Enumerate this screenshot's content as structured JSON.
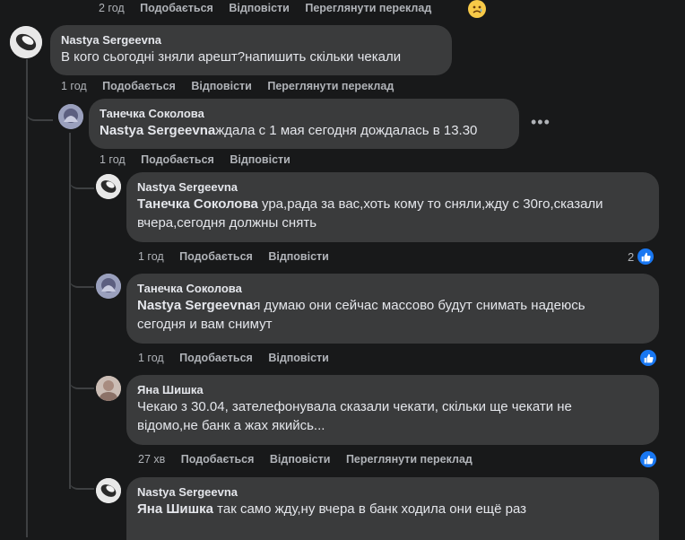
{
  "top_row": {
    "time": "2 год",
    "like": "Подобається",
    "reply": "Відповісти",
    "translate": "Переглянути переклад"
  },
  "comments": [
    {
      "author": "Nastya Sergeevna",
      "tag": "",
      "text": "В кого сьогодні зняли арешт?напишить скільки чекали",
      "time": "1 год",
      "like": "Подобається",
      "reply": "Відповісти",
      "translate": "Переглянути переклад"
    },
    {
      "author": "Танечка Соколова",
      "tag": "Nastya Sergeevna",
      "text": "ждала с 1 мая сегодня дождалась в 13.30",
      "time": "1 год",
      "like": "Подобається",
      "reply": "Відповісти"
    },
    {
      "author": "Nastya Sergeevna",
      "tag": "Танечка Соколова",
      "text_line1": " ура,рада за вас,хоть кому то сняли,жду с 30го,сказали",
      "text_line2": "вчера,сегодня должны снять",
      "time": "1 год",
      "like": "Подобається",
      "reply": "Відповісти",
      "reactions": "2"
    },
    {
      "author": "Танечка Соколова",
      "tag": "Nastya Sergeevna",
      "text_line1": "я думаю они сейчас массово будут снимать надеюсь",
      "text_line2": "сегодня и вам снимут",
      "time": "1 год",
      "like": "Подобається",
      "reply": "Відповісти"
    },
    {
      "author": "Яна Шишка",
      "tag": "",
      "text_line1": "Чекаю з 30.04, зателефонувала сказали чекати, скільки ще чекати не",
      "text_line2": "відомо,не банк а жах якийсь...",
      "time": "27 хв",
      "like": "Подобається",
      "reply": "Відповісти",
      "translate": "Переглянути переклад"
    },
    {
      "author": "Nastya Sergeevna",
      "tag": "Яна Шишка",
      "text": " так само жду,ну вчера в банк ходила они ещё раз"
    }
  ],
  "icons": {
    "like": "thumbs-up-icon",
    "more": "more-options-icon",
    "sad": "sad-emoji-icon"
  },
  "colors": {
    "bg": "#18191a",
    "bubble": "#3a3b3c",
    "like_blue": "#1877f2"
  }
}
